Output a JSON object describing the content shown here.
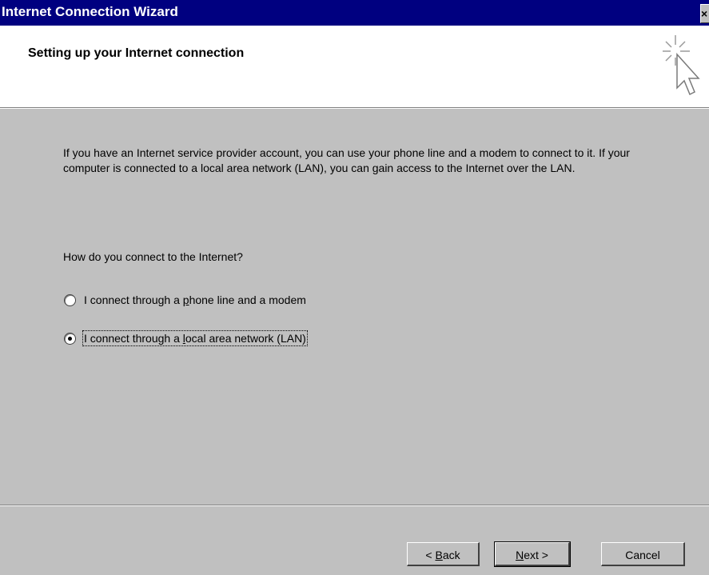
{
  "window": {
    "title": "Internet Connection Wizard",
    "close_glyph": "×"
  },
  "header": {
    "heading": "Setting up your Internet connection",
    "icon": "wizard-cursor-sparkle-icon"
  },
  "content": {
    "intro": "If you have an Internet service provider account, you can use your phone line and a modem to connect to it. If your computer is connected to a local area network (LAN), you can gain access to the Internet over the LAN.",
    "question": "How do you connect to the Internet?",
    "options": [
      {
        "label_pre": "I connect through a ",
        "label_u": "p",
        "label_post": "hone line and a modem",
        "selected": false
      },
      {
        "label_pre": "I connect through a ",
        "label_u": "l",
        "label_post": "ocal area network (LAN)",
        "selected": true
      }
    ]
  },
  "buttons": {
    "back_prefix": "< ",
    "back_u": "B",
    "back_rest": "ack",
    "next_u": "N",
    "next_rest": "ext >",
    "cancel": "Cancel"
  },
  "colors": {
    "titlebar": "#000080",
    "face": "#c0c0c0",
    "header_bg": "#ffffff"
  }
}
